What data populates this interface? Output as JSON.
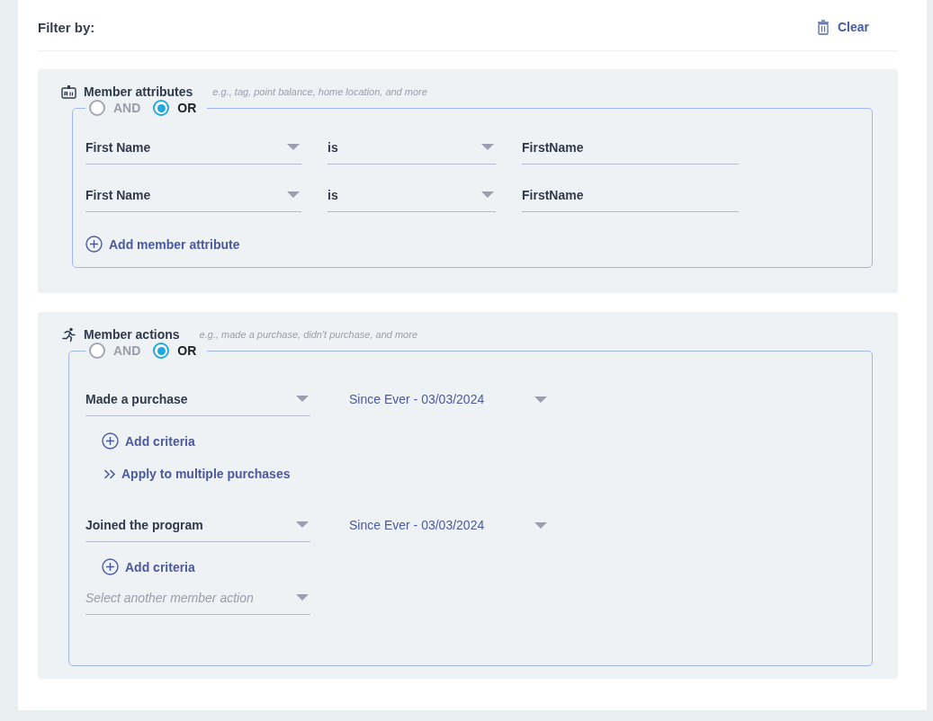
{
  "header": {
    "title": "Filter by:",
    "clear_button": "Clear"
  },
  "sections": [
    {
      "kind": "attributes",
      "title": "Member attributes",
      "hint": "e.g., tag, point balance, home location, and more",
      "logic": [
        {
          "label": "AND",
          "selected": false
        },
        {
          "label": "OR",
          "selected": true
        }
      ],
      "rows": [
        {
          "field": "First Name",
          "operator": "is",
          "value": "FirstName"
        },
        {
          "field": "First Name",
          "operator": "is",
          "value": "FirstName"
        }
      ],
      "add_button": "Add member attribute"
    },
    {
      "kind": "actions",
      "title": "Member actions",
      "hint": "e.g., made a purchase, didn't purchase, and more",
      "logic": [
        {
          "label": "AND",
          "selected": false
        },
        {
          "label": "OR",
          "selected": true
        }
      ],
      "actions": [
        {
          "action": "Made a purchase",
          "date_range": "Since Ever - 03/03/2024",
          "add_criteria": "Add criteria",
          "apply_multiple": "Apply to multiple purchases"
        },
        {
          "action": "Joined the program",
          "date_range": "Since Ever - 03/03/2024",
          "add_criteria": "Add criteria"
        }
      ],
      "next_action": {
        "placeholder": "Select another member action"
      }
    }
  ]
}
